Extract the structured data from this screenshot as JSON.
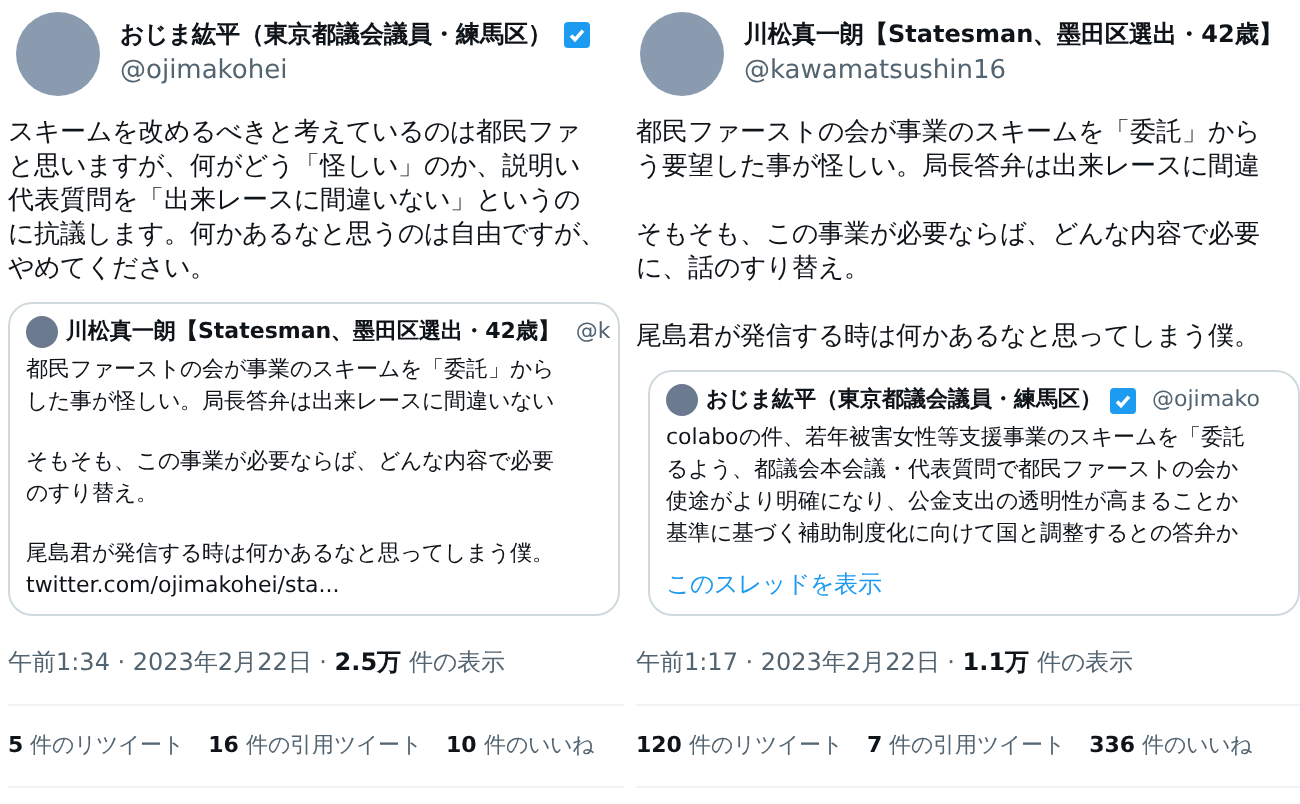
{
  "tweets": [
    {
      "author": {
        "name": "おじま紘平（東京都議会議員・練馬区）",
        "handle": "@ojimakohei",
        "verified": true
      },
      "paragraphs": [
        [
          "スキームを改めるべきと考えているのは都民ファ",
          "と思いますが、何がどう「怪しい」のか、説明い",
          "代表質問を「出来レースに間違いない」というの",
          "に抗議します。何かあるなと思うのは自由ですが、",
          "やめてください。"
        ]
      ],
      "quote": {
        "author": {
          "name": "川松真一朗【Statesman、墨田区選出・42歳】",
          "handle": "@k",
          "verified": false
        },
        "paragraphs": [
          [
            "都民ファーストの会が事業のスキームを「委託」から",
            "した事が怪しい。局長答弁は出来レースに間違いない"
          ],
          [
            "そもそも、この事業が必要ならば、どんな内容で必要",
            "のすり替え。"
          ],
          [
            "尾島君が発信する時は何かあるなと思ってしまう僕。",
            "twitter.com/ojimakohei/sta..."
          ]
        ]
      },
      "meta": "午前1:34 · 2023年2月22日 · **2.5万** 件の表示",
      "stats": [
        {
          "count": "5",
          "label": "件のリツイート"
        },
        {
          "count": "16",
          "label": "件の引用ツイート"
        },
        {
          "count": "10",
          "label": "件のいいね"
        }
      ]
    },
    {
      "author": {
        "name": "川松真一朗【Statesman、墨田区選出・42歳】",
        "handle": "@kawamatsushin16",
        "verified": false
      },
      "paragraphs": [
        [
          "都民ファーストの会が事業のスキームを「委託」から",
          "う要望した事が怪しい。局長答弁は出来レースに間違"
        ],
        [
          "そもそも、この事業が必要ならば、どんな内容で必要",
          "に、話のすり替え。"
        ],
        [
          "尾島君が発信する時は何かあるなと思ってしまう僕。"
        ]
      ],
      "quote": {
        "author": {
          "name": "おじま紘平（東京都議会議員・練馬区）",
          "handle": "@ojimako",
          "verified": true
        },
        "paragraphs": [
          [
            "colaboの件、若年被害女性等支援事業のスキームを「委託",
            "るよう、都議会本会議・代表質問で都民ファーストの会か",
            "使途がより明確になり、公金支出の透明性が高まることか",
            "基準に基づく補助制度化に向けて国と調整するとの答弁か"
          ]
        ],
        "link": "このスレッドを表示"
      },
      "meta": "午前1:17 · 2023年2月22日 · **1.1万** 件の表示",
      "stats": [
        {
          "count": "120",
          "label": "件のリツイート"
        },
        {
          "count": "7",
          "label": "件の引用ツイート"
        },
        {
          "count": "336",
          "label": "件のいいね"
        }
      ]
    }
  ]
}
